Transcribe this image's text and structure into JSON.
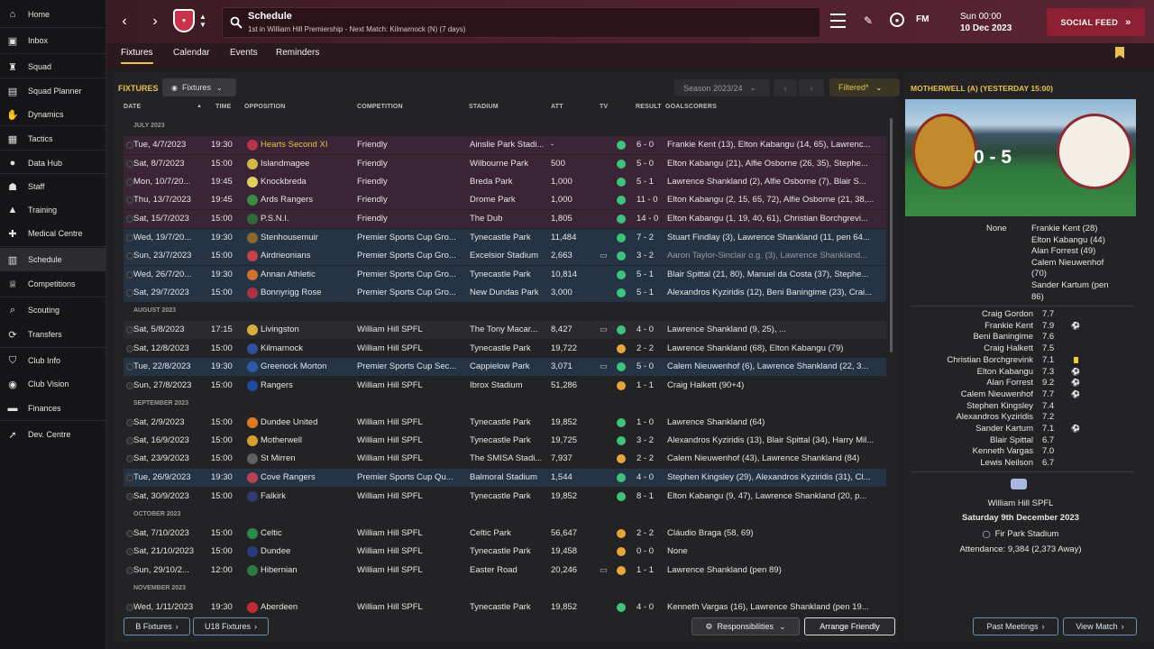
{
  "sidebar": {
    "items": [
      {
        "label": "Home",
        "icon": "home-icon"
      },
      {
        "label": "Inbox",
        "icon": "inbox-icon"
      },
      {
        "label": "Squad",
        "icon": "shirt-icon"
      },
      {
        "label": "Squad Planner",
        "icon": "clipboard-icon"
      },
      {
        "label": "Dynamics",
        "icon": "handshake-icon"
      },
      {
        "label": "Tactics",
        "icon": "tactics-board-icon"
      },
      {
        "label": "Data Hub",
        "icon": "data-hub-icon"
      },
      {
        "label": "Staff",
        "icon": "staff-icon"
      },
      {
        "label": "Training",
        "icon": "cone-icon"
      },
      {
        "label": "Medical Centre",
        "icon": "medical-icon"
      },
      {
        "label": "Schedule",
        "icon": "calendar-icon"
      },
      {
        "label": "Competitions",
        "icon": "trophy-icon"
      },
      {
        "label": "Scouting",
        "icon": "search-icon"
      },
      {
        "label": "Transfers",
        "icon": "transfer-icon"
      },
      {
        "label": "Club Info",
        "icon": "shield-icon"
      },
      {
        "label": "Club Vision",
        "icon": "vision-icon"
      },
      {
        "label": "Finances",
        "icon": "money-icon"
      },
      {
        "label": "Dev. Centre",
        "icon": "dev-centre-icon"
      }
    ]
  },
  "header": {
    "title": "Schedule",
    "subtitle": "1st in William Hill Premiership - Next Match: Kilmarnock (N) (7 days)",
    "club_code": "FM",
    "date_line1": "Sun 00:00",
    "date_line2": "10 Dec 2023",
    "social_feed": "SOCIAL FEED"
  },
  "tabs": [
    "Fixtures",
    "Calendar",
    "Events",
    "Reminders"
  ],
  "toolbar": {
    "section_label": "FIXTURES",
    "view_dropdown": "Fixtures",
    "season": "Season 2023/24",
    "filter": "Filtered*"
  },
  "columns": [
    "DATE",
    "TIME",
    "OPPOSITION",
    "COMPETITION",
    "STADIUM",
    "ATT",
    "TV",
    "RESULT",
    "GOALSCORERS"
  ],
  "groups": {
    "july": "JULY 2023",
    "august": "AUGUST 2023",
    "september": "SEPTEMBER 2023",
    "october": "OCTOBER 2023",
    "november": "NOVEMBER 2023"
  },
  "fixtures": [
    {
      "date": "Tue, 4/7/2023",
      "time": "19:30",
      "opp": "Hearts Second XI",
      "comp": "Friendly",
      "stadium": "Ainslie Park Stadi...",
      "att": "-",
      "tv": "",
      "res": "6 - 0",
      "outcome": "w",
      "scorers": "Frankie Kent (13), Elton Kabangu (14, 65), Lawrenc...",
      "style": "purple",
      "crest": "#b8344a"
    },
    {
      "date": "Sat, 8/7/2023",
      "time": "15:00",
      "opp": "Islandmagee",
      "comp": "Friendly",
      "stadium": "Wilbourne Park",
      "att": "500",
      "tv": "",
      "res": "5 - 0",
      "outcome": "w",
      "scorers": "Elton Kabangu (21), Alfie Osborne (26, 35), Stephe...",
      "style": "purple",
      "crest": "#d2b84a"
    },
    {
      "date": "Mon, 10/7/20...",
      "time": "19:45",
      "opp": "Knockbreda",
      "comp": "Friendly",
      "stadium": "Breda Park",
      "att": "1,000",
      "tv": "",
      "res": "5 - 1",
      "outcome": "w",
      "scorers": "Lawrence Shankland (2), Alfie Osborne (7), Blair S...",
      "style": "purple",
      "crest": "#e0d060"
    },
    {
      "date": "Thu, 13/7/2023",
      "time": "19:45",
      "opp": "Ards Rangers",
      "comp": "Friendly",
      "stadium": "Drome Park",
      "att": "1,000",
      "tv": "",
      "res": "11 - 0",
      "outcome": "w",
      "scorers": "Elton Kabangu (2, 15, 65, 72), Alfie Osborne (21, 38,...",
      "style": "purple",
      "crest": "#3a8a44"
    },
    {
      "date": "Sat, 15/7/2023",
      "time": "15:00",
      "opp": "P.S.N.I.",
      "comp": "Friendly",
      "stadium": "The Dub",
      "att": "1,805",
      "tv": "",
      "res": "14 - 0",
      "outcome": "w",
      "scorers": "Elton Kabangu (1, 19, 40, 61), Christian Borchgrevi...",
      "style": "purple",
      "crest": "#2d6a3a"
    },
    {
      "date": "Wed, 19/7/20...",
      "time": "19:30",
      "opp": "Stenhousemuir",
      "comp": "Premier Sports Cup Gro...",
      "stadium": "Tynecastle Park",
      "att": "11,484",
      "tv": "",
      "res": "7 - 2",
      "outcome": "w",
      "scorers": "Stuart Findlay (3), Lawrence Shankland (11, pen 64...",
      "style": "blue",
      "crest": "#8a6a2a"
    },
    {
      "date": "Sun, 23/7/2023",
      "time": "15:00",
      "opp": "Airdrieonians",
      "comp": "Premier Sports Cup Gro...",
      "stadium": "Excelsior Stadium",
      "att": "2,663",
      "tv": "tv",
      "res": "3 - 2",
      "outcome": "w",
      "scorers": "Aaron Taylor-Sinclair o.g. (3), Lawrence Shankland...",
      "style": "blue",
      "crest": "#c8404a"
    },
    {
      "date": "Wed, 26/7/20...",
      "time": "19:30",
      "opp": "Annan Athletic",
      "comp": "Premier Sports Cup Gro...",
      "stadium": "Tynecastle Park",
      "att": "10,814",
      "tv": "",
      "res": "5 - 1",
      "outcome": "w",
      "scorers": "Blair Spittal (21, 80), Manuel da Costa (37), Stephe...",
      "style": "blue",
      "crest": "#d07030"
    },
    {
      "date": "Sat, 29/7/2023",
      "time": "15:00",
      "opp": "Bonnyrigg Rose",
      "comp": "Premier Sports Cup Gro...",
      "stadium": "New Dundas Park",
      "att": "3,000",
      "tv": "",
      "res": "5 - 1",
      "outcome": "w",
      "scorers": "Alexandros Kyziridis (12), Beni Baningime (23), Crai...",
      "style": "blue",
      "crest": "#b03040"
    },
    {
      "date": "Sat, 5/8/2023",
      "time": "17:15",
      "opp": "Livingston",
      "comp": "William Hill SPFL",
      "stadium": "The Tony Macar...",
      "att": "8,427",
      "tv": "tv",
      "res": "4 - 0",
      "outcome": "w",
      "scorers": "Lawrence Shankland (9, 25), ...",
      "style": "dark",
      "crest": "#d8b040"
    },
    {
      "date": "Sat, 12/8/2023",
      "time": "15:00",
      "opp": "Kilmarnock",
      "comp": "William Hill SPFL",
      "stadium": "Tynecastle Park",
      "att": "19,722",
      "tv": "",
      "res": "2 - 2",
      "outcome": "d",
      "scorers": "Lawrence Shankland (68), Elton Kabangu (79)",
      "style": "",
      "crest": "#3050a0"
    },
    {
      "date": "Tue, 22/8/2023",
      "time": "19:30",
      "opp": "Greenock Morton",
      "comp": "Premier Sports Cup Sec...",
      "stadium": "Cappielow Park",
      "att": "3,071",
      "tv": "tv",
      "res": "5 - 0",
      "outcome": "w",
      "scorers": "Calem Nieuwenhof (6), Lawrence Shankland (22, 3...",
      "style": "blue",
      "crest": "#2c5aa8"
    },
    {
      "date": "Sun, 27/8/2023",
      "time": "15:00",
      "opp": "Rangers",
      "comp": "William Hill SPFL",
      "stadium": "Ibrox Stadium",
      "att": "51,286",
      "tv": "",
      "res": "1 - 1",
      "outcome": "d",
      "scorers": "Craig Halkett (90+4)",
      "style": "",
      "crest": "#1e4aa0"
    },
    {
      "date": "Sat, 2/9/2023",
      "time": "15:00",
      "opp": "Dundee United",
      "comp": "William Hill SPFL",
      "stadium": "Tynecastle Park",
      "att": "19,852",
      "tv": "",
      "res": "1 - 0",
      "outcome": "w",
      "scorers": "Lawrence Shankland (64)",
      "style": "",
      "crest": "#e07820"
    },
    {
      "date": "Sat, 16/9/2023",
      "time": "15:00",
      "opp": "Motherwell",
      "comp": "William Hill SPFL",
      "stadium": "Tynecastle Park",
      "att": "19,725",
      "tv": "",
      "res": "3 - 2",
      "outcome": "w",
      "scorers": "Alexandros Kyziridis (13), Blair Spittal (34), Harry Mil...",
      "style": "",
      "crest": "#d8a030"
    },
    {
      "date": "Sat, 23/9/2023",
      "time": "15:00",
      "opp": "St Mirren",
      "comp": "William Hill SPFL",
      "stadium": "The SMISA Stadi...",
      "att": "7,937",
      "tv": "",
      "res": "2 - 2",
      "outcome": "d",
      "scorers": "Calem Nieuwenhof (43), Lawrence Shankland (84)",
      "style": "",
      "crest": "#606060"
    },
    {
      "date": "Tue, 26/9/2023",
      "time": "19:30",
      "opp": "Cove Rangers",
      "comp": "Premier Sports Cup Qu...",
      "stadium": "Balmoral Stadium",
      "att": "1,544",
      "tv": "",
      "res": "4 - 0",
      "outcome": "w",
      "scorers": "Stephen Kingsley (29), Alexandros Kyziridis (31), Cl...",
      "style": "blue",
      "crest": "#b84050"
    },
    {
      "date": "Sat, 30/9/2023",
      "time": "15:00",
      "opp": "Falkirk",
      "comp": "William Hill SPFL",
      "stadium": "Tynecastle Park",
      "att": "19,852",
      "tv": "",
      "res": "8 - 1",
      "outcome": "w",
      "scorers": "Elton Kabangu (9, 47), Lawrence Shankland (20, p...",
      "style": "",
      "crest": "#303a70"
    },
    {
      "date": "Sat, 7/10/2023",
      "time": "15:00",
      "opp": "Celtic",
      "comp": "William Hill SPFL",
      "stadium": "Celtic Park",
      "att": "56,647",
      "tv": "",
      "res": "2 - 2",
      "outcome": "d",
      "scorers": "Cláudio Braga (58, 69)",
      "style": "",
      "crest": "#2a8a4a"
    },
    {
      "date": "Sat, 21/10/2023",
      "time": "15:00",
      "opp": "Dundee",
      "comp": "William Hill SPFL",
      "stadium": "Tynecastle Park",
      "att": "19,458",
      "tv": "",
      "res": "0 - 0",
      "outcome": "d",
      "scorers": "None",
      "style": "",
      "crest": "#2a3a80"
    },
    {
      "date": "Sun, 29/10/2...",
      "time": "12:00",
      "opp": "Hibernian",
      "comp": "William Hill SPFL",
      "stadium": "Easter Road",
      "att": "20,246",
      "tv": "tv",
      "res": "1 - 1",
      "outcome": "d",
      "scorers": "Lawrence Shankland (pen 89)",
      "style": "",
      "crest": "#2a7a40"
    },
    {
      "date": "Wed, 1/11/2023",
      "time": "19:30",
      "opp": "Aberdeen",
      "comp": "William Hill SPFL",
      "stadium": "Tynecastle Park",
      "att": "19,852",
      "tv": "",
      "res": "4 - 0",
      "outcome": "w",
      "scorers": "Kenneth Vargas (16), Lawrence Shankland (pen 19...",
      "style": "",
      "crest": "#c02a30"
    }
  ],
  "bottom": {
    "b_fixtures": "B Fixtures",
    "u18_fixtures": "U18 Fixtures",
    "responsibilities": "Responsibilities",
    "arrange_friendly": "Arrange Friendly",
    "past_meetings": "Past Meetings",
    "view_match": "View Match"
  },
  "last_match": {
    "title": "MOTHERWELL (A) (YESTERDAY 15:00)",
    "score": "0 - 5",
    "home_scorers": "None",
    "away_scorers": [
      "Frankie Kent (28)",
      "Elton Kabangu (44)",
      "Alan Forrest (49)",
      "Calem Nieuwenhof",
      "(70)",
      "Sander Kartum (pen",
      "86)"
    ],
    "ratings": [
      {
        "name": "Craig Gordon",
        "r": "7.7",
        "mark": ""
      },
      {
        "name": "Frankie Kent",
        "r": "7.9",
        "mark": "goal"
      },
      {
        "name": "Beni Baningime",
        "r": "7.6",
        "mark": ""
      },
      {
        "name": "Craig Halkett",
        "r": "7.5",
        "mark": ""
      },
      {
        "name": "Christian Borchgrevink",
        "r": "7.1",
        "mark": "yellow"
      },
      {
        "name": "Elton Kabangu",
        "r": "7.3",
        "mark": "goal"
      },
      {
        "name": "Alan Forrest",
        "r": "9.2",
        "mark": "goal"
      },
      {
        "name": "Calem Nieuwenhof",
        "r": "7.7",
        "mark": "goal"
      },
      {
        "name": "Stephen Kingsley",
        "r": "7.4",
        "mark": ""
      },
      {
        "name": "Alexandros Kyziridis",
        "r": "7.2",
        "mark": ""
      },
      {
        "name": "Sander Kartum",
        "r": "7.1",
        "mark": "goal"
      },
      {
        "name": "Blair Spittal",
        "r": "6.7",
        "mark": ""
      },
      {
        "name": "Kenneth Vargas",
        "r": "7.0",
        "mark": ""
      },
      {
        "name": "Lewis Neilson",
        "r": "6.7",
        "mark": ""
      }
    ],
    "competition": "William Hill SPFL",
    "date": "Saturday 9th December 2023",
    "stadium": "Fir Park Stadium",
    "attendance": "Attendance: 9,384 (2,373 Away)"
  },
  "colors": {
    "accent": "#e8c24a",
    "header": "#4a1f2b",
    "social": "#8c1f32",
    "win": "#3ec27c",
    "draw": "#e6a63a"
  }
}
